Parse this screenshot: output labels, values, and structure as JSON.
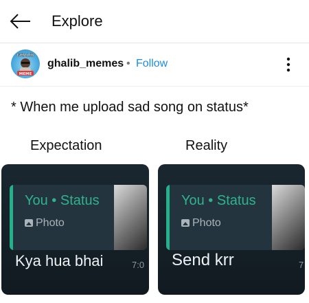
{
  "header": {
    "title": "Explore",
    "back_icon": "back-arrow-icon"
  },
  "post": {
    "username": "ghalib_memes",
    "separator": "•",
    "follow_label": "Follow",
    "more_icon": "more-vertical-icon",
    "avatar_text": [
      "GHALIB",
      "MEME"
    ],
    "caption": "* When me upload sad song on status*"
  },
  "meme": {
    "left_label": "Expectation",
    "right_label": "Reality",
    "panels": [
      {
        "quote_title": "You • Status",
        "quote_sub": "Photo",
        "reply": "Kya hua bhai",
        "time": "7:0"
      },
      {
        "quote_title": "You • Status",
        "quote_sub": "Photo",
        "reply": "Send krr",
        "time": "7"
      }
    ]
  },
  "colors": {
    "follow": "#1b8ce6",
    "status_green": "#2fb38e",
    "panel_bg": "#1a2730"
  }
}
